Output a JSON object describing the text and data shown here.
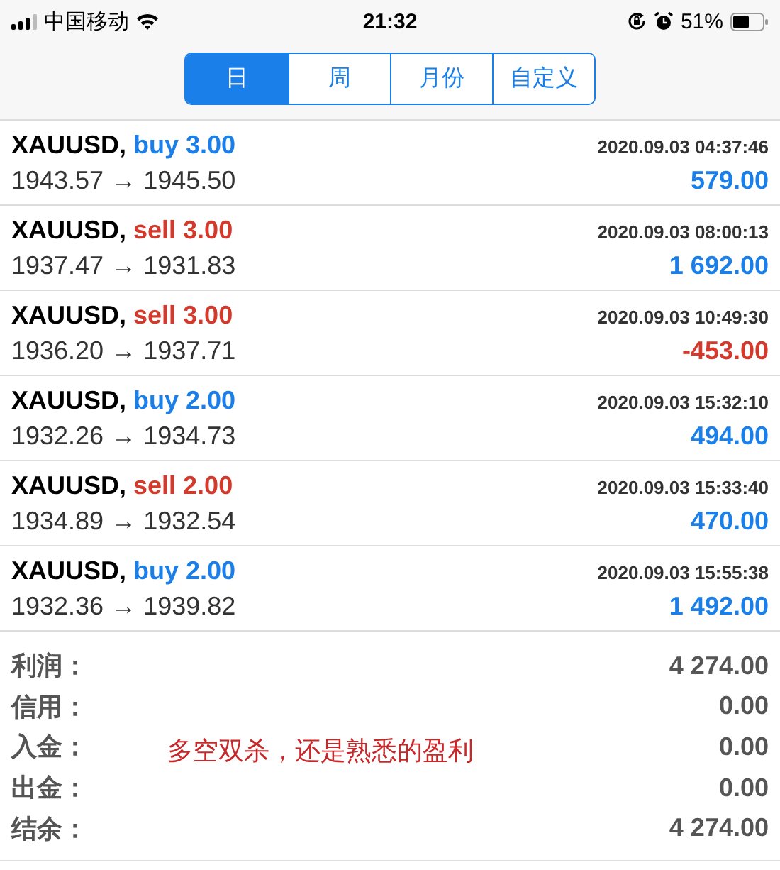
{
  "status_bar": {
    "carrier": "中国移动",
    "time": "21:32",
    "battery": "51%"
  },
  "tabs": [
    {
      "label": "日",
      "selected": true
    },
    {
      "label": "周",
      "selected": false
    },
    {
      "label": "月份",
      "selected": false
    },
    {
      "label": "自定义",
      "selected": false
    }
  ],
  "trades": [
    {
      "symbol": "XAUUSD,",
      "side": "buy",
      "volume": "3.00",
      "time": "2020.09.03 04:37:46",
      "prices": "1943.57 → 1945.50",
      "profit": "579.00",
      "negative": false
    },
    {
      "symbol": "XAUUSD,",
      "side": "sell",
      "volume": "3.00",
      "time": "2020.09.03 08:00:13",
      "prices": "1937.47 → 1931.83",
      "profit": "1 692.00",
      "negative": false
    },
    {
      "symbol": "XAUUSD,",
      "side": "sell",
      "volume": "3.00",
      "time": "2020.09.03 10:49:30",
      "prices": "1936.20 → 1937.71",
      "profit": "-453.00",
      "negative": true
    },
    {
      "symbol": "XAUUSD,",
      "side": "buy",
      "volume": "2.00",
      "time": "2020.09.03 15:32:10",
      "prices": "1932.26 → 1934.73",
      "profit": "494.00",
      "negative": false
    },
    {
      "symbol": "XAUUSD,",
      "side": "sell",
      "volume": "2.00",
      "time": "2020.09.03 15:33:40",
      "prices": "1934.89 → 1932.54",
      "profit": "470.00",
      "negative": false
    },
    {
      "symbol": "XAUUSD,",
      "side": "buy",
      "volume": "2.00",
      "time": "2020.09.03 15:55:38",
      "prices": "1932.36 → 1939.82",
      "profit": "1 492.00",
      "negative": false
    }
  ],
  "summary": [
    {
      "label": "利润：",
      "value": "4 274.00"
    },
    {
      "label": "信用：",
      "value": "0.00"
    },
    {
      "label": "入金：",
      "value": "0.00"
    },
    {
      "label": "出金：",
      "value": "0.00"
    },
    {
      "label": "结余：",
      "value": "4 274.00"
    }
  ],
  "annotation": "多空双杀，还是熟悉的盈利"
}
